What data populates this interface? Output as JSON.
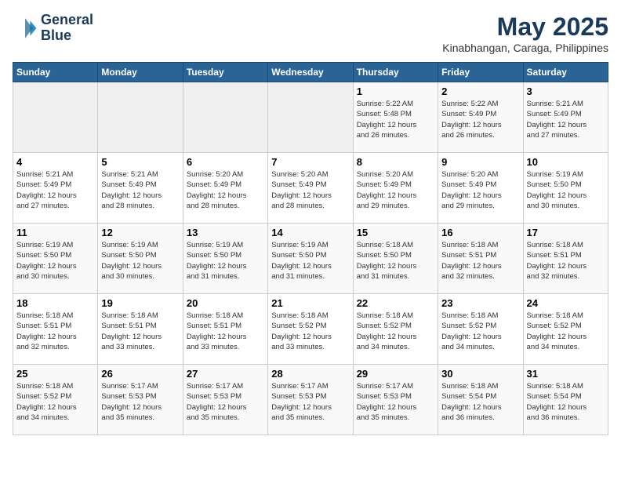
{
  "header": {
    "logo_line1": "General",
    "logo_line2": "Blue",
    "month": "May 2025",
    "location": "Kinabhangan, Caraga, Philippines"
  },
  "weekdays": [
    "Sunday",
    "Monday",
    "Tuesday",
    "Wednesday",
    "Thursday",
    "Friday",
    "Saturday"
  ],
  "weeks": [
    [
      {
        "day": "",
        "info": ""
      },
      {
        "day": "",
        "info": ""
      },
      {
        "day": "",
        "info": ""
      },
      {
        "day": "",
        "info": ""
      },
      {
        "day": "1",
        "info": "Sunrise: 5:22 AM\nSunset: 5:48 PM\nDaylight: 12 hours\nand 26 minutes."
      },
      {
        "day": "2",
        "info": "Sunrise: 5:22 AM\nSunset: 5:49 PM\nDaylight: 12 hours\nand 26 minutes."
      },
      {
        "day": "3",
        "info": "Sunrise: 5:21 AM\nSunset: 5:49 PM\nDaylight: 12 hours\nand 27 minutes."
      }
    ],
    [
      {
        "day": "4",
        "info": "Sunrise: 5:21 AM\nSunset: 5:49 PM\nDaylight: 12 hours\nand 27 minutes."
      },
      {
        "day": "5",
        "info": "Sunrise: 5:21 AM\nSunset: 5:49 PM\nDaylight: 12 hours\nand 28 minutes."
      },
      {
        "day": "6",
        "info": "Sunrise: 5:20 AM\nSunset: 5:49 PM\nDaylight: 12 hours\nand 28 minutes."
      },
      {
        "day": "7",
        "info": "Sunrise: 5:20 AM\nSunset: 5:49 PM\nDaylight: 12 hours\nand 28 minutes."
      },
      {
        "day": "8",
        "info": "Sunrise: 5:20 AM\nSunset: 5:49 PM\nDaylight: 12 hours\nand 29 minutes."
      },
      {
        "day": "9",
        "info": "Sunrise: 5:20 AM\nSunset: 5:49 PM\nDaylight: 12 hours\nand 29 minutes."
      },
      {
        "day": "10",
        "info": "Sunrise: 5:19 AM\nSunset: 5:50 PM\nDaylight: 12 hours\nand 30 minutes."
      }
    ],
    [
      {
        "day": "11",
        "info": "Sunrise: 5:19 AM\nSunset: 5:50 PM\nDaylight: 12 hours\nand 30 minutes."
      },
      {
        "day": "12",
        "info": "Sunrise: 5:19 AM\nSunset: 5:50 PM\nDaylight: 12 hours\nand 30 minutes."
      },
      {
        "day": "13",
        "info": "Sunrise: 5:19 AM\nSunset: 5:50 PM\nDaylight: 12 hours\nand 31 minutes."
      },
      {
        "day": "14",
        "info": "Sunrise: 5:19 AM\nSunset: 5:50 PM\nDaylight: 12 hours\nand 31 minutes."
      },
      {
        "day": "15",
        "info": "Sunrise: 5:18 AM\nSunset: 5:50 PM\nDaylight: 12 hours\nand 31 minutes."
      },
      {
        "day": "16",
        "info": "Sunrise: 5:18 AM\nSunset: 5:51 PM\nDaylight: 12 hours\nand 32 minutes."
      },
      {
        "day": "17",
        "info": "Sunrise: 5:18 AM\nSunset: 5:51 PM\nDaylight: 12 hours\nand 32 minutes."
      }
    ],
    [
      {
        "day": "18",
        "info": "Sunrise: 5:18 AM\nSunset: 5:51 PM\nDaylight: 12 hours\nand 32 minutes."
      },
      {
        "day": "19",
        "info": "Sunrise: 5:18 AM\nSunset: 5:51 PM\nDaylight: 12 hours\nand 33 minutes."
      },
      {
        "day": "20",
        "info": "Sunrise: 5:18 AM\nSunset: 5:51 PM\nDaylight: 12 hours\nand 33 minutes."
      },
      {
        "day": "21",
        "info": "Sunrise: 5:18 AM\nSunset: 5:52 PM\nDaylight: 12 hours\nand 33 minutes."
      },
      {
        "day": "22",
        "info": "Sunrise: 5:18 AM\nSunset: 5:52 PM\nDaylight: 12 hours\nand 34 minutes."
      },
      {
        "day": "23",
        "info": "Sunrise: 5:18 AM\nSunset: 5:52 PM\nDaylight: 12 hours\nand 34 minutes."
      },
      {
        "day": "24",
        "info": "Sunrise: 5:18 AM\nSunset: 5:52 PM\nDaylight: 12 hours\nand 34 minutes."
      }
    ],
    [
      {
        "day": "25",
        "info": "Sunrise: 5:18 AM\nSunset: 5:52 PM\nDaylight: 12 hours\nand 34 minutes."
      },
      {
        "day": "26",
        "info": "Sunrise: 5:17 AM\nSunset: 5:53 PM\nDaylight: 12 hours\nand 35 minutes."
      },
      {
        "day": "27",
        "info": "Sunrise: 5:17 AM\nSunset: 5:53 PM\nDaylight: 12 hours\nand 35 minutes."
      },
      {
        "day": "28",
        "info": "Sunrise: 5:17 AM\nSunset: 5:53 PM\nDaylight: 12 hours\nand 35 minutes."
      },
      {
        "day": "29",
        "info": "Sunrise: 5:17 AM\nSunset: 5:53 PM\nDaylight: 12 hours\nand 35 minutes."
      },
      {
        "day": "30",
        "info": "Sunrise: 5:18 AM\nSunset: 5:54 PM\nDaylight: 12 hours\nand 36 minutes."
      },
      {
        "day": "31",
        "info": "Sunrise: 5:18 AM\nSunset: 5:54 PM\nDaylight: 12 hours\nand 36 minutes."
      }
    ]
  ]
}
